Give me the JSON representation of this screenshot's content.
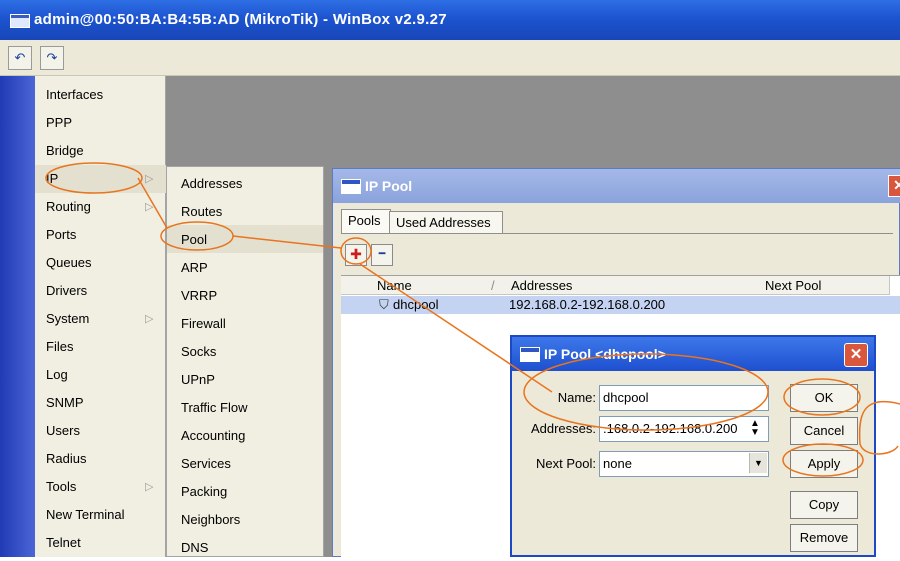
{
  "window": {
    "title": "admin@00:50:BA:B4:5B:AD (MikroTik) - WinBox v2.9.27"
  },
  "toolbar": {
    "undo": "↶",
    "redo": "↷"
  },
  "main_menu": [
    "Interfaces",
    "PPP",
    "Bridge",
    "IP",
    "Routing",
    "Ports",
    "Queues",
    "Drivers",
    "System",
    "Files",
    "Log",
    "SNMP",
    "Users",
    "Radius",
    "Tools",
    "New Terminal",
    "Telnet"
  ],
  "submenu": [
    "Addresses",
    "Routes",
    "Pool",
    "ARP",
    "VRRP",
    "Firewall",
    "Socks",
    "UPnP",
    "Traffic Flow",
    "Accounting",
    "Services",
    "Packing",
    "Neighbors",
    "DNS"
  ],
  "ip_pool": {
    "title": "IP Pool",
    "tabs": [
      "Pools",
      "Used Addresses"
    ],
    "add_glyph": "✚",
    "remove_glyph": "━",
    "close_glyph": "✕",
    "columns": [
      "Name",
      "Addresses",
      "Next Pool"
    ],
    "sort_glyph": "/",
    "row": {
      "icon": "⛉",
      "name": "dhcpool",
      "addresses": "192.168.0.2-192.168.0.200",
      "next_pool": ""
    }
  },
  "dialog": {
    "title": "IP Pool <dhcpool>",
    "close_glyph": "✕",
    "name_label": "Name:",
    "name_value": "dhcpool",
    "addresses_label": "Addresses:",
    "addresses_value": ".168.0.2-192.168.0.200",
    "next_pool_label": "Next Pool:",
    "next_pool_value": "none",
    "buttons": [
      "OK",
      "Cancel",
      "Apply",
      "Copy",
      "Remove"
    ]
  }
}
